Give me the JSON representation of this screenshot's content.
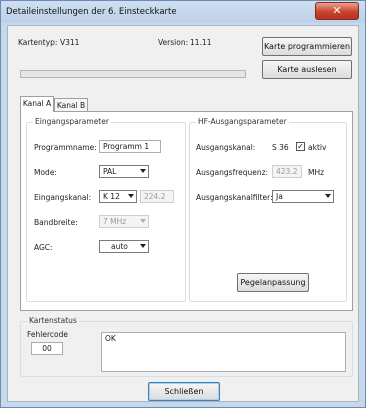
{
  "window": {
    "title": "Detaileinstellungen der 6. Einsteckkarte",
    "close_glyph": "✕"
  },
  "header": {
    "kartentyp_label": "Kartentyp:",
    "kartentyp_value": "V311",
    "version_label": "Version:",
    "version_value": "11.11",
    "program_button": "Karte programmieren",
    "read_button": "Karte auslesen",
    "progress_fraction": 0
  },
  "tabs": [
    {
      "label": "Kanal A"
    },
    {
      "label": "Kanal B"
    }
  ],
  "eingang": {
    "group_label": "Eingangsparameter",
    "programmname_label": "Programmname:",
    "programmname_value": "Programm 1",
    "mode_label": "Mode:",
    "mode_value": "PAL",
    "kanal_label": "Eingangskanal:",
    "kanal_value": "K 12",
    "kanal_freq": "224.2",
    "bandbreite_label": "Bandbreite:",
    "bandbreite_value": "7 MHz",
    "agc_label": "AGC:",
    "agc_value": "auto"
  },
  "hf": {
    "group_label": "HF-Ausgangsparameter",
    "kanal_label": "Ausgangskanal:",
    "kanal_value": "S 36",
    "aktiv_label": "aktiv",
    "aktiv_checked": true,
    "freq_label": "Ausgangsfrequenz:",
    "freq_value": "423.2",
    "freq_unit": "MHz",
    "filter_label": "Ausgangskanalfilter:",
    "filter_value": "Ja",
    "pegel_button": "Pegelanpassung"
  },
  "status": {
    "group_label": "Kartenstatus",
    "fehler_label": "Fehlercode",
    "fehler_value": "00",
    "message": "OK"
  },
  "footer": {
    "close_button": "Schließen"
  }
}
